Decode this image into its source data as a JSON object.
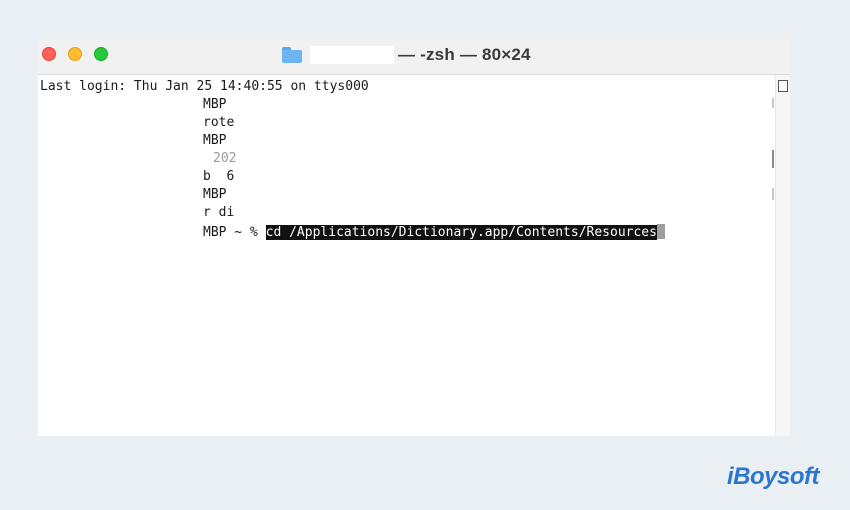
{
  "window": {
    "title": "— -zsh — 80×24"
  },
  "terminal": {
    "lines": [
      "Last login: Thu Jan 25 14:40:55 on ttys000",
      "MBP",
      "rote",
      "MBP",
      "202",
      "b  6",
      "MBP",
      "r di"
    ],
    "prompt": "MBP ~ % ",
    "command": "cd /Applications/Dictionary.app/Contents/Resources"
  },
  "brand": {
    "logo_text": "iBoysoft"
  },
  "colors": {
    "background": "#e9eff3",
    "close": "#fe5f57",
    "minimize": "#febc2e",
    "zoom": "#28c840",
    "selection": "#111111",
    "logo": "#2d77cf"
  }
}
